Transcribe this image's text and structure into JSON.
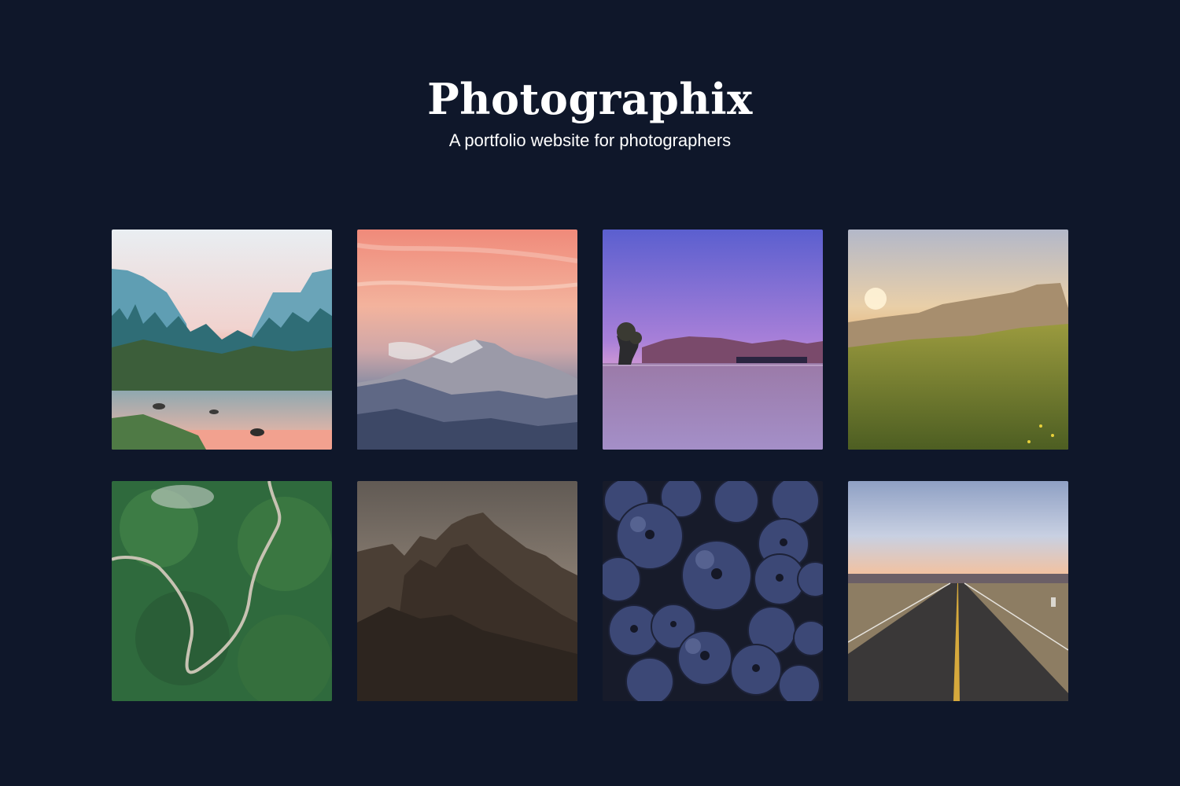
{
  "header": {
    "title": "Photographix",
    "subtitle": "A portfolio website for photographers"
  },
  "colors": {
    "background": "#0f172a",
    "text": "#ffffff"
  },
  "gallery": {
    "photos": [
      {
        "subject": "misty valley river with cliffs at sunrise"
      },
      {
        "subject": "snowy mountain under pink sunset sky"
      },
      {
        "subject": "lone tree in purple lake at dusk"
      },
      {
        "subject": "grassy meadow with sun setting behind mesa"
      },
      {
        "subject": "aerial winding road through green forest"
      },
      {
        "subject": "jagged rocky mountain peaks under cloudy sky"
      },
      {
        "subject": "close-up of blueberries"
      },
      {
        "subject": "empty highway stretching to horizon"
      }
    ]
  }
}
